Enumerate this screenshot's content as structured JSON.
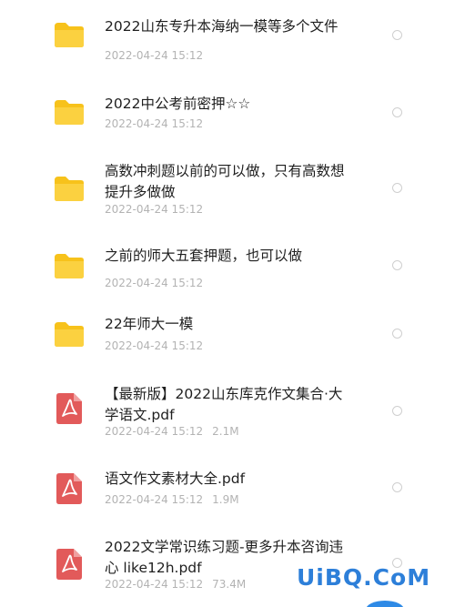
{
  "files": [
    {
      "name": "2022山东专升本海纳一模等多个文件",
      "date": "2022-04-24 15:12",
      "size": "",
      "kind": "folder",
      "icon": "folder-icon"
    },
    {
      "name": "2022中公考前密押☆☆",
      "date": "2022-04-24 15:12",
      "size": "",
      "kind": "folder",
      "icon": "folder-icon"
    },
    {
      "name": "高数冲刺题以前的可以做，只有高数想提升多做做",
      "date": "2022-04-24 15:12",
      "size": "",
      "kind": "folder",
      "icon": "folder-icon"
    },
    {
      "name": "之前的师大五套押题，也可以做",
      "date": "2022-04-24 15:12",
      "size": "",
      "kind": "folder",
      "icon": "folder-icon"
    },
    {
      "name": "22年师大一模",
      "date": "2022-04-24 15:12",
      "size": "",
      "kind": "folder",
      "icon": "folder-icon"
    },
    {
      "name": "【最新版】2022山东库克作文集合·大学语文.pdf",
      "date": "2022-04-24 15:12",
      "size": "2.1M",
      "kind": "pdf",
      "icon": "pdf-icon"
    },
    {
      "name": "语文作文素材大全.pdf",
      "date": "2022-04-24 15:12",
      "size": "1.9M",
      "kind": "pdf",
      "icon": "pdf-icon"
    },
    {
      "name": "2022文学常识练习题-更多升本咨询违心 like12h.pdf",
      "date": "2022-04-24 15:12",
      "size": "73.4M",
      "kind": "pdf",
      "icon": "pdf-icon"
    }
  ],
  "watermark": "UiBQ.CoM",
  "colors": {
    "folder": "#f7c21b",
    "pdf": "#e25a5a",
    "title": "#1f1f1f",
    "meta": "#b3b3b3",
    "watermark": "#2d7fd9"
  }
}
